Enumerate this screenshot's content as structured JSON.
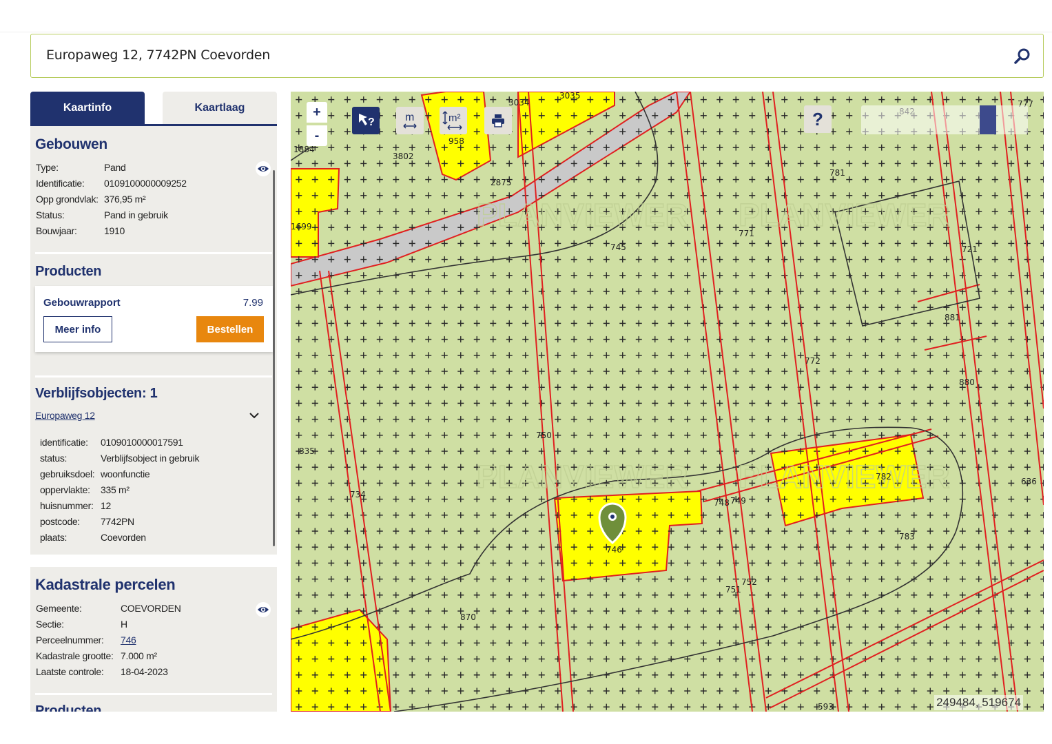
{
  "search": {
    "value": "Europaweg 12, 7742PN Coevorden"
  },
  "tabs": [
    {
      "label": "Kaartinfo",
      "active": true
    },
    {
      "label": "Kaartlaag",
      "active": false
    }
  ],
  "gebouwen": {
    "title": "Gebouwen",
    "fields": [
      {
        "key": "Type:",
        "value": "Pand"
      },
      {
        "key": "Identificatie:",
        "value": "0109100000009252"
      },
      {
        "key": "Opp grondvlak:",
        "value": "376,95 m²"
      },
      {
        "key": "Status:",
        "value": "Pand in gebruik"
      },
      {
        "key": "Bouwjaar:",
        "value": "1910"
      }
    ]
  },
  "producten": {
    "title": "Producten",
    "item": {
      "name": "Gebouwrapport",
      "price": "7.99",
      "info_label": "Meer info",
      "order_label": "Bestellen"
    }
  },
  "verblijfsobjecten": {
    "title": "Verblijfsobjecten: 1",
    "address_link": "Europaweg 12",
    "fields": [
      {
        "key": "identificatie:",
        "value": "0109010000017591"
      },
      {
        "key": "status:",
        "value": "Verblijfsobject in gebruik"
      },
      {
        "key": "gebruiksdoel:",
        "value": "woonfunctie"
      },
      {
        "key": "oppervlakte:",
        "value": "335 m²"
      },
      {
        "key": "huisnummer:",
        "value": "12"
      },
      {
        "key": "postcode:",
        "value": "7742PN"
      },
      {
        "key": "plaats:",
        "value": "Coevorden"
      }
    ]
  },
  "kadastrale": {
    "title": "Kadastrale percelen",
    "fields": [
      {
        "key": "Gemeente:",
        "value": "COEVORDEN"
      },
      {
        "key": "Sectie:",
        "value": "H"
      },
      {
        "key": "Perceelnummer:",
        "value": "746"
      },
      {
        "key": "Kadastrale grootte:",
        "value": "7.000 m²"
      },
      {
        "key": "Laatste controle:",
        "value": "18-04-2023"
      }
    ],
    "cut_off_heading": "Producten"
  },
  "map": {
    "zoom_in": "+",
    "zoom_out": "-",
    "measure_length_label": "m",
    "measure_area_label": "m²",
    "help_label": "?",
    "coordinates": "249484, 519674",
    "watermark": "PLANVIEWER",
    "parcel_numbers": [
      "3034",
      "3035",
      "777",
      "1884",
      "3802",
      "958",
      "842",
      "2875",
      "781",
      "1699",
      "771",
      "745",
      "721",
      "881",
      "772",
      "880",
      "750",
      "835",
      "782",
      "734",
      "748",
      "749",
      "746",
      "783",
      "636",
      "752",
      "751",
      "870",
      "593"
    ],
    "colors": {
      "base": "#cfdfa3",
      "parcel_fill": "#ffff00",
      "road": "#c9c9c9",
      "parcel_line": "#e02020",
      "contour_line": "#333333",
      "marker": "#6f8f3a",
      "brand": "#20326e",
      "order": "#e8870e"
    }
  }
}
